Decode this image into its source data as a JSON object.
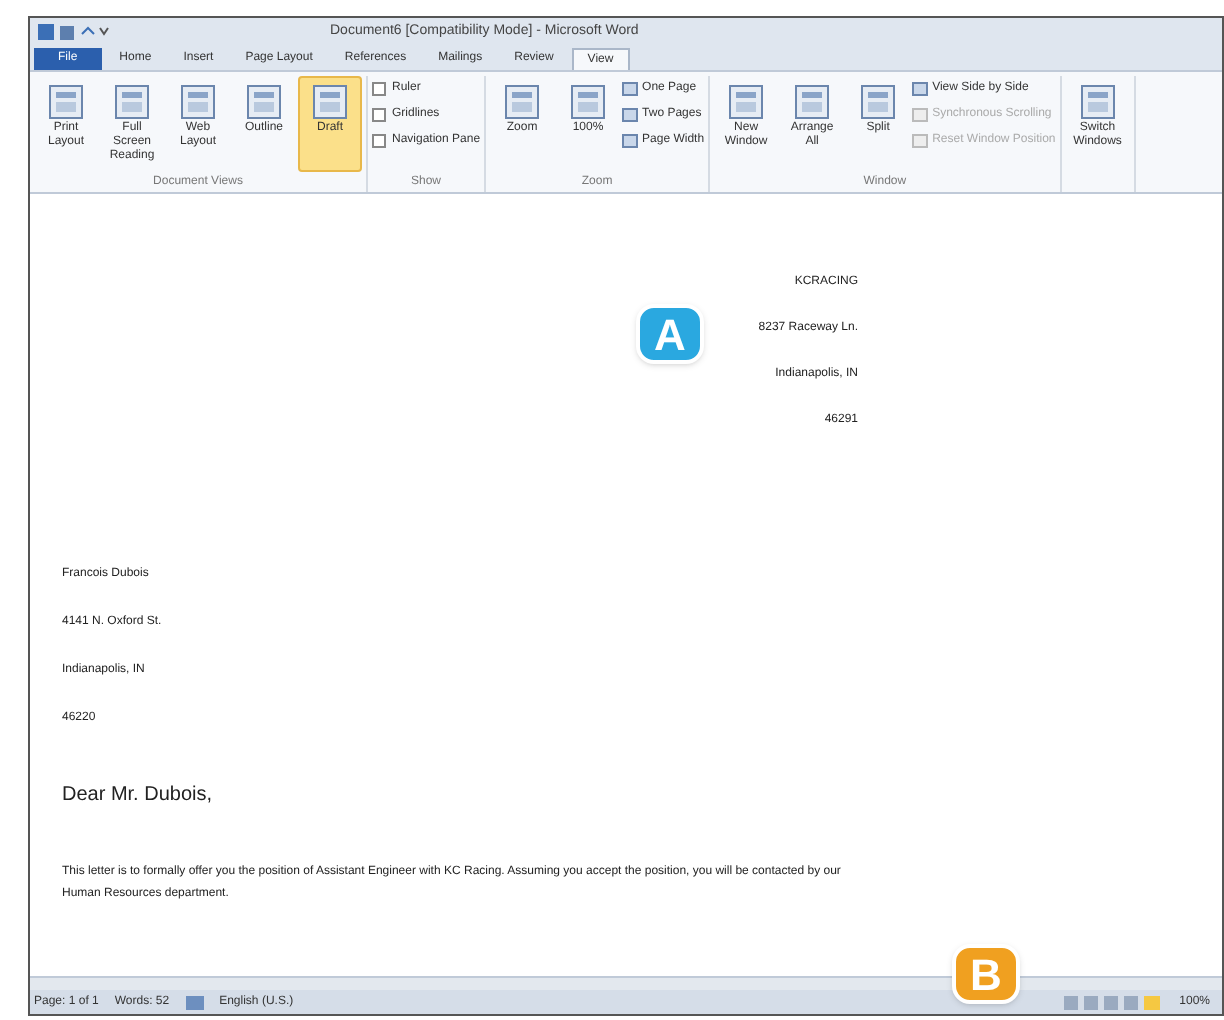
{
  "window": {
    "title": "Document6 [Compatibility Mode] - Microsoft Word"
  },
  "tabs": [
    {
      "label": "File",
      "selected": false,
      "kind": "file"
    },
    {
      "label": "Home",
      "selected": false
    },
    {
      "label": "Insert",
      "selected": false
    },
    {
      "label": "Page Layout",
      "selected": false
    },
    {
      "label": "References",
      "selected": false
    },
    {
      "label": "Mailings",
      "selected": false
    },
    {
      "label": "Review",
      "selected": false
    },
    {
      "label": "View",
      "selected": true
    }
  ],
  "ribbon": {
    "groups": [
      {
        "label": "Document Views",
        "items": [
          {
            "kind": "large",
            "label": "Print Layout",
            "selected": false
          },
          {
            "kind": "large",
            "label": "Full Screen Reading",
            "selected": false
          },
          {
            "kind": "large",
            "label": "Web Layout",
            "selected": false
          },
          {
            "kind": "large",
            "label": "Outline",
            "selected": false
          },
          {
            "kind": "large",
            "label": "Draft",
            "selected": true
          }
        ]
      },
      {
        "label": "Show",
        "items": [
          {
            "kind": "check",
            "label": "Ruler",
            "checked": false
          },
          {
            "kind": "check",
            "label": "Gridlines",
            "checked": false
          },
          {
            "kind": "check",
            "label": "Navigation Pane",
            "checked": false
          }
        ]
      },
      {
        "label": "Zoom",
        "items": [
          {
            "kind": "large",
            "label": "Zoom",
            "selected": false
          },
          {
            "kind": "large",
            "label": "100%",
            "selected": false
          },
          {
            "kind": "small",
            "label": "One Page",
            "disabled": false
          },
          {
            "kind": "small",
            "label": "Two Pages",
            "disabled": false
          },
          {
            "kind": "small",
            "label": "Page Width",
            "disabled": false
          }
        ]
      },
      {
        "label": "Window",
        "items": [
          {
            "kind": "large",
            "label": "New Window",
            "selected": false
          },
          {
            "kind": "large",
            "label": "Arrange All",
            "selected": false
          },
          {
            "kind": "large",
            "label": "Split",
            "selected": false
          },
          {
            "kind": "small",
            "label": "View Side by Side",
            "disabled": false
          },
          {
            "kind": "small",
            "label": "Synchronous Scrolling",
            "disabled": true
          },
          {
            "kind": "small",
            "label": "Reset Window Position",
            "disabled": true
          }
        ]
      },
      {
        "items": [
          {
            "kind": "large",
            "label": "Switch Windows",
            "selected": false
          }
        ]
      }
    ]
  },
  "document": {
    "sender": [
      "KCRACING",
      "8237 Raceway Ln.",
      "Indianapolis, IN",
      "46291"
    ],
    "recipient": [
      "Francois Dubois",
      "4141 N. Oxford St.",
      "Indianapolis, IN",
      "46220"
    ],
    "salutation": "Dear Mr. Dubois,",
    "body": "This letter is to formally offer you the position of Assistant Engineer with KC Racing. Assuming you accept the position, you will be contacted by our Human Resources department."
  },
  "status_bar": {
    "page": "Page: 1 of 1",
    "words": "Words: 52",
    "language": "English (U.S.)",
    "zoom": "100%"
  },
  "callouts": [
    {
      "label": "A",
      "color": "#2aa8e0"
    },
    {
      "label": "B",
      "color": "#f0a020"
    }
  ]
}
